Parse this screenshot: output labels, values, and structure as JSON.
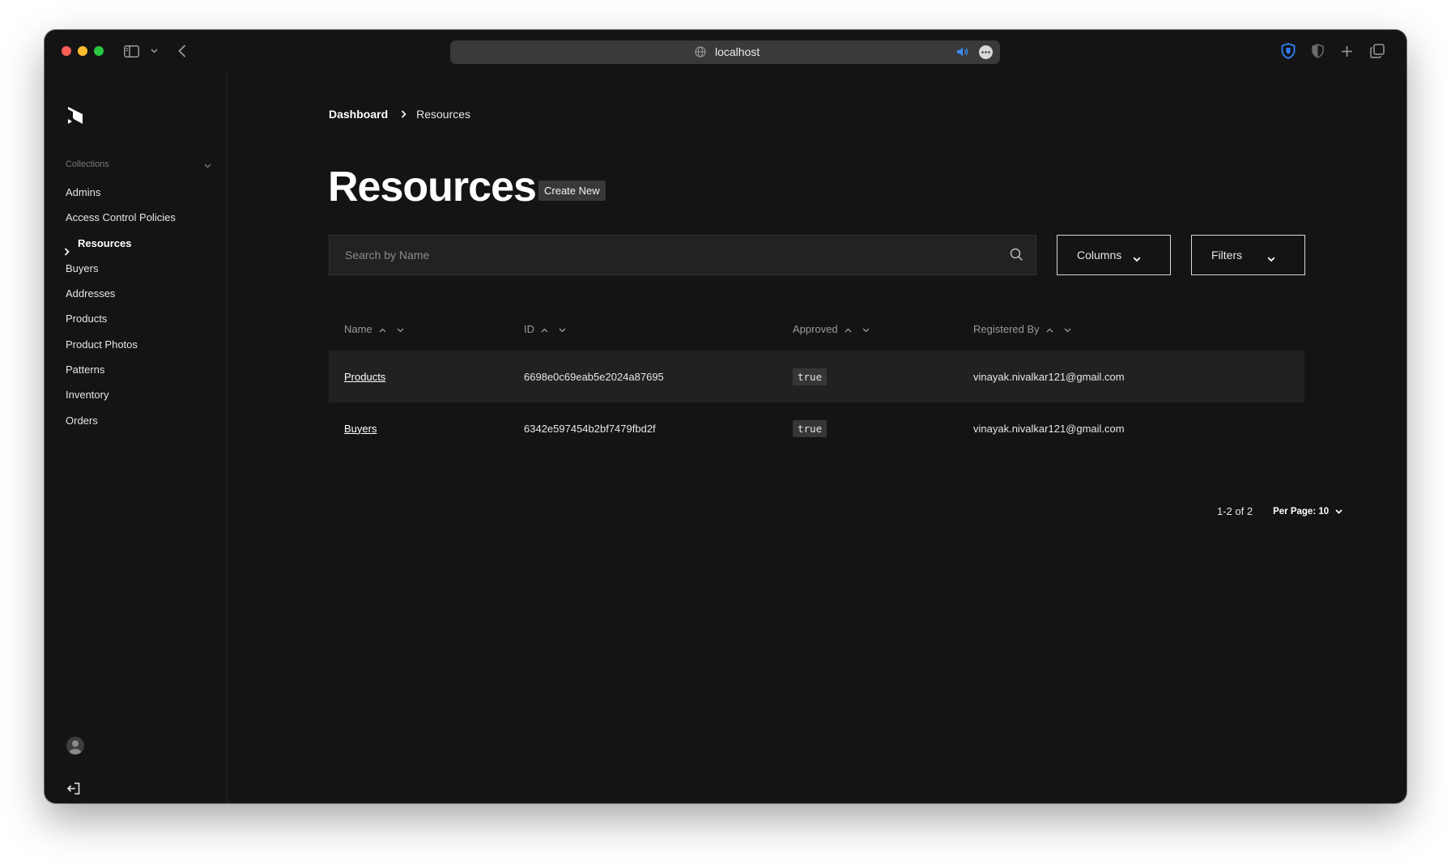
{
  "browser": {
    "url": "localhost"
  },
  "sidebar": {
    "section_label": "Collections",
    "items": [
      {
        "label": "Admins",
        "active": false
      },
      {
        "label": "Access Control Policies",
        "active": false
      },
      {
        "label": "Resources",
        "active": true
      },
      {
        "label": "Buyers",
        "active": false
      },
      {
        "label": "Addresses",
        "active": false
      },
      {
        "label": "Products",
        "active": false
      },
      {
        "label": "Product Photos",
        "active": false
      },
      {
        "label": "Patterns",
        "active": false
      },
      {
        "label": "Inventory",
        "active": false
      },
      {
        "label": "Orders",
        "active": false
      }
    ]
  },
  "breadcrumb": {
    "root": "Dashboard",
    "current": "Resources"
  },
  "page": {
    "title": "Resources",
    "create_label": "Create New"
  },
  "search": {
    "placeholder": "Search by Name",
    "value": ""
  },
  "toolbar": {
    "columns_label": "Columns",
    "filters_label": "Filters"
  },
  "table": {
    "headers": [
      "Name",
      "ID",
      "Approved",
      "Registered By"
    ],
    "rows": [
      {
        "name": "Products",
        "id": "6698e0c69eab5e2024a87695",
        "approved": "true",
        "registered_by": "vinayak.nivalkar121@gmail.com"
      },
      {
        "name": "Buyers",
        "id": "6342e597454b2bf7479fbd2f",
        "approved": "true",
        "registered_by": "vinayak.nivalkar121@gmail.com"
      }
    ]
  },
  "pagination": {
    "range": "1-2 of 2",
    "per_page": "Per Page: 10"
  },
  "colors": {
    "background": "#141414",
    "sidebar_border": "#262626",
    "row_alt": "#212121",
    "text": "#e6e6e6"
  },
  "icons": {
    "logo": "payload-logo-icon",
    "search": "search-icon",
    "logout": "logout-icon",
    "avatar": "user-avatar-icon"
  }
}
